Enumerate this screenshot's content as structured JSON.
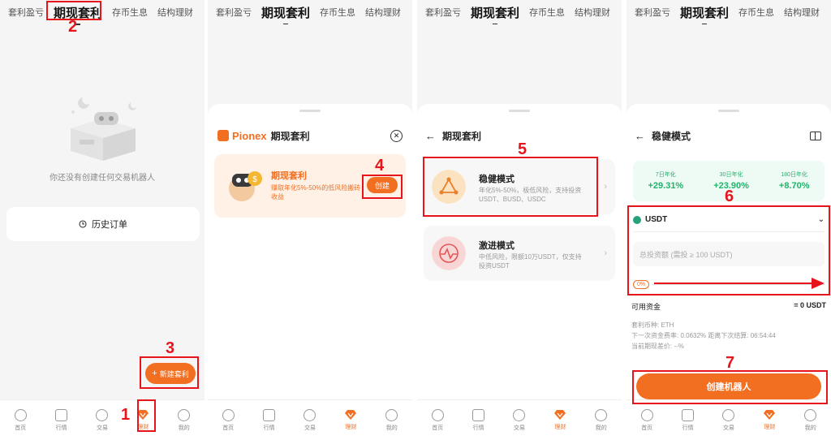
{
  "tabs": {
    "profit": "套利盈亏",
    "spot_arb": "期现套利",
    "savings": "存币生息",
    "structured": "结构理财"
  },
  "empty": {
    "message": "你还没有创建任何交易机器人",
    "history": "历史订单",
    "new_button": "新建套利"
  },
  "nav": {
    "home": "首页",
    "market": "行情",
    "trade": "交易",
    "finance": "理财",
    "me": "我的"
  },
  "sheet": {
    "brand": "Pionex",
    "title": "期现套利",
    "card_title": "期现套利",
    "card_desc": "赚取年化5%-50%的低风险搬砖收益",
    "create": "创建"
  },
  "modes": {
    "title": "期现套利",
    "steady_title": "稳健模式",
    "steady_desc": "年化5%-50%，极低风险，支持投资USDT、BUSD、USDC",
    "aggressive_title": "激进模式",
    "aggressive_desc": "中低风险，限额10万USDT，仅支持投资USDT"
  },
  "steady": {
    "title": "稳健模式",
    "rates": [
      {
        "label": "7日年化",
        "value": "+29.31%"
      },
      {
        "label": "30日年化",
        "value": "+23.90%"
      },
      {
        "label": "180日年化",
        "value": "+8.70%"
      }
    ],
    "coin": "USDT",
    "amount_placeholder": "总投资额 (需投 ≥ 100 USDT)",
    "percent": "0%",
    "available_label": "可用资金",
    "available_value": "= 0 USDT",
    "info_coin": "套利币种: ETH",
    "info_rate": "下一次资金费率: 0.0632%    距离下次结算: 06:54:44",
    "info_diff": "当前期现差价: --%",
    "create_bot": "创建机器人"
  },
  "annotations": {
    "n1": "1",
    "n2": "2",
    "n3": "3",
    "n4": "4",
    "n5": "5",
    "n6": "6",
    "n7": "7"
  },
  "colors": {
    "accent": "#f26f21",
    "annotation": "#e8141b",
    "positive": "#21b36b"
  }
}
